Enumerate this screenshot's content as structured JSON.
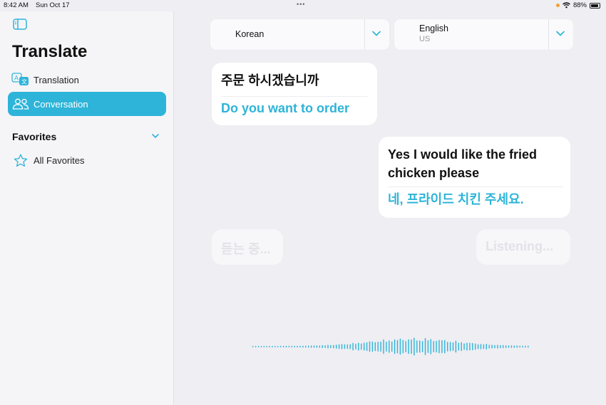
{
  "status_bar": {
    "time": "8:42 AM",
    "date": "Sun Oct 17",
    "battery": "88%",
    "dots": "•••"
  },
  "sidebar": {
    "title": "Translate",
    "items": [
      {
        "label": "Translation",
        "icon": "translation-icon",
        "active": false
      },
      {
        "label": "Conversation",
        "icon": "people-icon",
        "active": true
      }
    ],
    "favorites": {
      "title": "Favorites",
      "items": [
        {
          "label": "All Favorites",
          "icon": "star-icon"
        }
      ]
    }
  },
  "languages": {
    "source": {
      "name": "Korean"
    },
    "target": {
      "name": "English",
      "region": "US"
    }
  },
  "conversation": [
    {
      "source": "주문 하시겠습니까",
      "translation": "Do you want to order",
      "side": "left"
    },
    {
      "source": "Yes I would like the fried chicken please",
      "translation": "네, 프라이드 치킨 주세요.",
      "side": "right"
    }
  ],
  "listening": {
    "left_placeholder": "듣는 중...",
    "right_placeholder": "Listening..."
  },
  "colors": {
    "accent": "#2eb4d8",
    "background": "#eeeef3",
    "sidebar": "#f5f5f8",
    "bubble": "#ffffff"
  }
}
